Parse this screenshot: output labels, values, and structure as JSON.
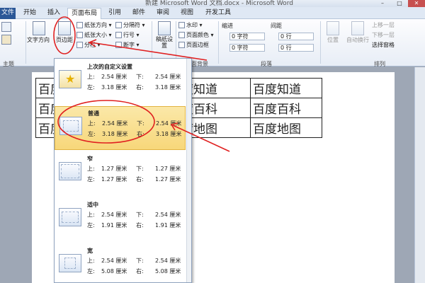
{
  "window": {
    "title": "新建 Microsoft Word 文档.docx - Microsoft Word",
    "minimize": "–",
    "maximize": "□",
    "close": "✕"
  },
  "tabs": [
    {
      "label": "文件"
    },
    {
      "label": "开始"
    },
    {
      "label": "插入"
    },
    {
      "label": "页面布局"
    },
    {
      "label": "引用"
    },
    {
      "label": "邮件"
    },
    {
      "label": "审阅"
    },
    {
      "label": "视图"
    },
    {
      "label": "开发工具"
    }
  ],
  "ribbon": {
    "theme_group": "主题",
    "text_direction": "文字方向",
    "margins": "页边距",
    "orientation": "纸张方向",
    "size": "纸张大小",
    "columns": "分栏",
    "breaks": "分隔符",
    "line_numbers": "行号",
    "hyphenation": "断字",
    "draft_paper": "稿纸设置",
    "watermark": "水印",
    "page_color": "页面颜色",
    "page_border": "页面边框",
    "page_bg_group": "页面背景",
    "indent": "缩进",
    "spacing": "间距",
    "indent_left": "0 字符",
    "indent_right": "0 字符",
    "spacing_before": "0 行",
    "spacing_after": "0 行",
    "paragraph_group": "段落",
    "position": "位置",
    "wrap_text": "自动换行",
    "bring_forward": "上移一层",
    "send_backward": "下移一层",
    "selection_pane": "选择窗格",
    "arrange_group": "排列"
  },
  "document": {
    "rows": [
      [
        "百度",
        "",
        "度知道",
        "百度知道"
      ],
      [
        "百度",
        "",
        "度百科",
        "百度百科"
      ],
      [
        "百度",
        "",
        "度地图",
        "百度地图"
      ]
    ]
  },
  "margins_menu": {
    "options": [
      {
        "title": "上次的自定义设置",
        "top_label": "上:",
        "top": "2.54 厘米",
        "bottom_label": "下:",
        "bottom": "2.54 厘米",
        "left_label": "左:",
        "left": "3.18 厘米",
        "right_label": "右:",
        "right": "3.18 厘米"
      },
      {
        "title": "普通",
        "top_label": "上:",
        "top": "2.54 厘米",
        "bottom_label": "下:",
        "bottom": "2.54 厘米",
        "left_label": "左:",
        "left": "3.18 厘米",
        "right_label": "右:",
        "right": "3.18 厘米"
      },
      {
        "title": "窄",
        "top_label": "上:",
        "top": "1.27 厘米",
        "bottom_label": "下:",
        "bottom": "1.27 厘米",
        "left_label": "左:",
        "left": "1.27 厘米",
        "right_label": "右:",
        "right": "1.27 厘米"
      },
      {
        "title": "适中",
        "top_label": "上:",
        "top": "2.54 厘米",
        "bottom_label": "下:",
        "bottom": "2.54 厘米",
        "left_label": "左:",
        "left": "1.91 厘米",
        "right_label": "右:",
        "right": "1.91 厘米"
      },
      {
        "title": "宽",
        "top_label": "上:",
        "top": "2.54 厘米",
        "bottom_label": "下:",
        "bottom": "2.54 厘米",
        "left_label": "左:",
        "left": "5.08 厘米",
        "right_label": "右:",
        "right": "5.08 厘米"
      }
    ]
  },
  "colors": {
    "accent": "#2b5797",
    "highlight": "#f7d77a",
    "annotation": "#e02020"
  }
}
